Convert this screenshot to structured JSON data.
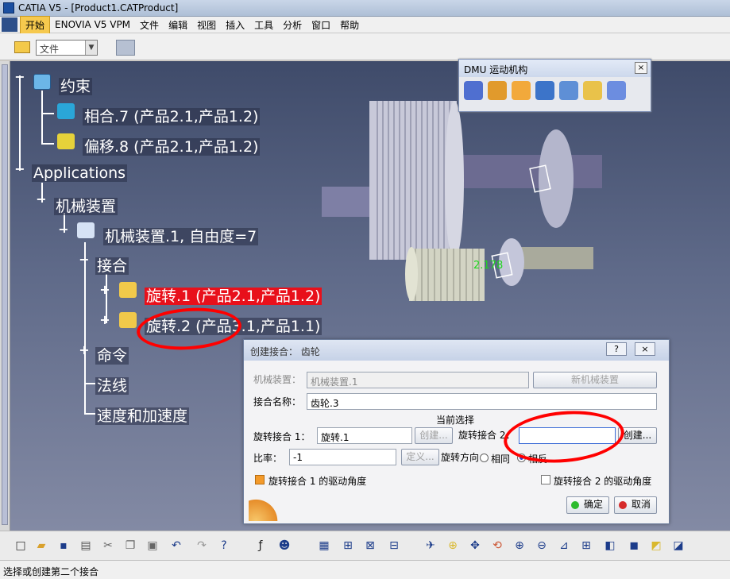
{
  "window": {
    "title": "CATIA V5 - [Product1.CATProduct]"
  },
  "menu": {
    "items": [
      "开始",
      "ENOVIA V5 VPM",
      "文件",
      "编辑",
      "视图",
      "插入",
      "工具",
      "分析",
      "窗口",
      "帮助"
    ],
    "active_index": 0
  },
  "toolbar": {
    "file_combo": "文件"
  },
  "tree": {
    "constraints": "约束",
    "coincidence": "相合.7 (产品2.1,产品1.2)",
    "offset": "偏移.8 (产品2.1,产品1.2)",
    "applications": "Applications",
    "mechanisms": "机械装置",
    "mechanism1": "机械装置.1, 自由度=7",
    "joints": "接合",
    "rev1": "旋转.1 (产品2.1,产品1.2)",
    "rev2": "旋转.2 (产品3.1,产品1.1)",
    "commands": "命令",
    "laws": "法线",
    "speed": "速度和加速度"
  },
  "viewport": {
    "annotation": "2.178"
  },
  "dmu_toolbar": {
    "title": "DMU 运动机构",
    "close": "×",
    "icons": [
      "rotate-joint-icon",
      "assembly-constraint-icon",
      "gear-joint-icon",
      "fix-part-icon",
      "simulate-icon",
      "commands-icon",
      "analyze-icon"
    ]
  },
  "dialog": {
    "title": "创建接合： 齿轮",
    "help": "?",
    "close": "×",
    "mechanism_label": "机械装置：",
    "mechanism_value": "机械装置.1",
    "new_mechanism": "新机械装置",
    "joint_name_label": "接合名称：",
    "joint_name_value": "齿轮.3",
    "current_selection": "当前选择",
    "rev1_label": "旋转接合 1：",
    "rev1_value": "旋转.1",
    "create1": "创建...",
    "rev2_label": "旋转接合 2：",
    "rev2_value": "",
    "create2": "创建...",
    "ratio_label": "比率：",
    "ratio_value": "-1",
    "define": "定义...",
    "direction_label": "旋转方向",
    "same": "相同",
    "opposite": "相反",
    "drive1": "旋转接合 1 的驱动角度",
    "drive2": "旋转接合 2 的驱动角度",
    "ok": "确定",
    "cancel": "取消"
  },
  "status": {
    "text": "选择或创建第二个接合"
  }
}
